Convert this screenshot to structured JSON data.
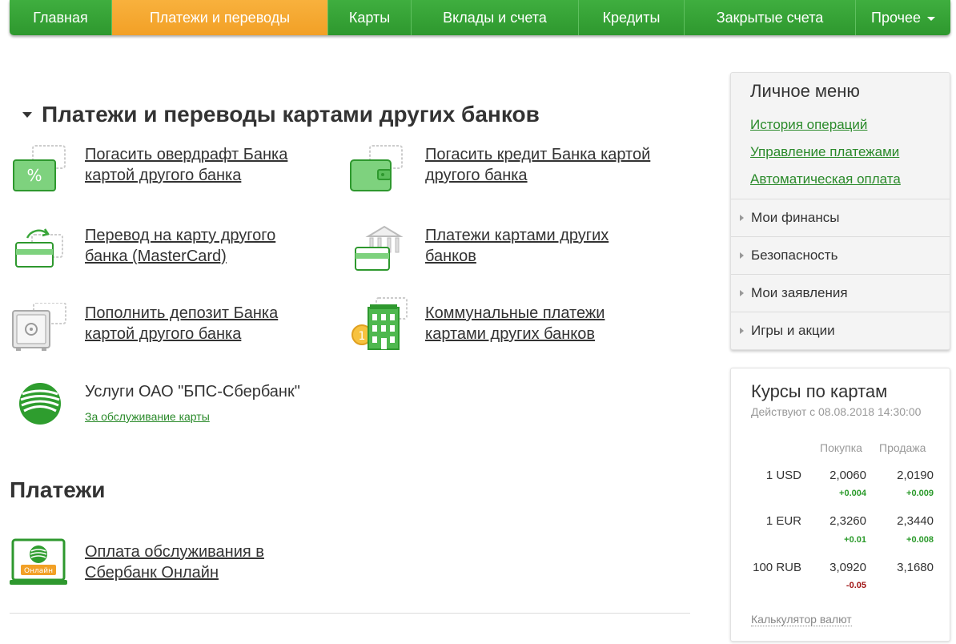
{
  "nav": {
    "items": [
      "Главная",
      "Платежи и переводы",
      "Карты",
      "Вклады и счета",
      "Кредиты",
      "Закрытые счета",
      "Прочее"
    ]
  },
  "section": {
    "title": "Платежи и переводы картами других банков",
    "items": [
      {
        "label": "Погасить овердрафт Банка картой другого банка",
        "icon": "percent-card-icon"
      },
      {
        "label": "Погасить кредит Банка картой другого банка",
        "icon": "wallet-card-icon"
      },
      {
        "label": "Перевод на карту другого банка (MasterCard)",
        "icon": "card-transfer-icon"
      },
      {
        "label": "Платежи картами других банков",
        "icon": "bank-card-icon"
      },
      {
        "label": "Пополнить депозит Банка картой другого банка",
        "icon": "safe-card-icon"
      },
      {
        "label": "Коммунальные платежи картами других банков",
        "icon": "building-card-icon"
      }
    ],
    "service": {
      "title": "Услуги ОАО \"БПС-Сбербанк\"",
      "link": "За обслуживание карты"
    }
  },
  "payments": {
    "title": "Платежи",
    "item": {
      "label": "Оплата обслуживания в Сбербанк Онлайн",
      "badge": "Онлайн"
    }
  },
  "personal_menu": {
    "title": "Личное меню",
    "links": [
      "История операций",
      "Управление платежами",
      "Автоматическая оплата"
    ],
    "rows": [
      "Мои финансы",
      "Безопасность",
      "Мои заявления",
      "Игры и акции"
    ]
  },
  "rates": {
    "title": "Курсы по картам",
    "subtitle": "Действуют с 08.08.2018 14:30:00",
    "col_buy": "Покупка",
    "col_sell": "Продажа",
    "rows": [
      {
        "currency": "1 USD",
        "buy": "2,0060",
        "sell": "2,0190",
        "buy_delta": "+0.004",
        "sell_delta": "+0.009"
      },
      {
        "currency": "1 EUR",
        "buy": "2,3260",
        "sell": "2,3440",
        "buy_delta": "+0.01",
        "sell_delta": "+0.008"
      },
      {
        "currency": "100 RUB",
        "buy": "3,0920",
        "sell": "3,1680",
        "buy_delta": "-0.05",
        "sell_delta": ""
      }
    ],
    "calculator": "Калькулятор валют"
  },
  "colors": {
    "brand_green": "#2e982e",
    "active_orange": "#f2a026",
    "link_green": "#2a8a2a"
  }
}
